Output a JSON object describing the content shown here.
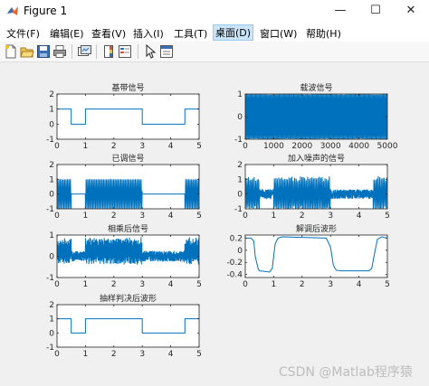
{
  "window": {
    "title": "Figure 1",
    "minimize": "—",
    "maximize": "☐",
    "close": "✕"
  },
  "menu": [
    "文件(F)",
    "编辑(E)",
    "查看(V)",
    "插入(I)",
    "工具(T)",
    "桌面(D)",
    "窗口(W)",
    "帮助(H)"
  ],
  "menu_active_index": 5,
  "toolbar_icons": [
    "new-figure-icon",
    "open-file-icon",
    "save-icon",
    "print-icon",
    "link-plot-icon",
    "insert-colorbar-icon",
    "insert-legend-icon",
    "edit-plot-icon",
    "property-inspector-icon"
  ],
  "colors": {
    "line": "#0072BD",
    "axes_bg": "#ffffff",
    "figure_bg": "#f0f0f0"
  },
  "chart_data": [
    {
      "type": "line",
      "title": "基带信号",
      "xlim": [
        0,
        5
      ],
      "ylim": [
        -1,
        2
      ],
      "xticks": [
        "0",
        "1",
        "2",
        "3",
        "4",
        "5"
      ],
      "yticks": [
        "2",
        "1",
        "0",
        "-1"
      ],
      "x": [
        0,
        0.5,
        0.5,
        1,
        1,
        3,
        3,
        4.5,
        4.5,
        5
      ],
      "y": [
        1,
        1,
        0,
        0,
        1,
        1,
        0,
        0,
        1,
        1
      ]
    },
    {
      "type": "line",
      "title": "载波信号",
      "xlim": [
        0,
        5000
      ],
      "ylim": [
        -1,
        1
      ],
      "xticks": [
        "0",
        "1000",
        "2000",
        "3000",
        "4000",
        "5000"
      ],
      "yticks": [
        "1",
        "0",
        "-1"
      ],
      "signal": "carrier",
      "amplitude": 1
    },
    {
      "type": "line",
      "title": "已调信号",
      "xlim": [
        0,
        5
      ],
      "ylim": [
        -1,
        2
      ],
      "xticks": [
        "0",
        "1",
        "2",
        "3",
        "4",
        "5"
      ],
      "yticks": [
        "2",
        "1",
        "0",
        "-1"
      ],
      "signal": "ook",
      "amplitude": 1
    },
    {
      "type": "line",
      "title": "加入噪声的信号",
      "xlim": [
        0,
        5
      ],
      "ylim": [
        -1,
        2
      ],
      "xticks": [
        "0",
        "1",
        "2",
        "3",
        "4",
        "5"
      ],
      "yticks": [
        "2",
        "1",
        "0",
        "-1"
      ],
      "signal": "ook+noise",
      "amplitude": 1
    },
    {
      "type": "line",
      "title": "相乘后信号",
      "xlim": [
        0,
        5
      ],
      "ylim": [
        -1,
        1
      ],
      "xticks": [
        "0",
        "1",
        "2",
        "3",
        "4",
        "5"
      ],
      "yticks": [
        "1",
        "0",
        "-1"
      ],
      "signal": "product"
    },
    {
      "type": "line",
      "title": "解调后波形",
      "xlim": [
        0,
        5
      ],
      "ylim": [
        -0.45,
        0.25
      ],
      "xticks": [
        "0",
        "1",
        "2",
        "3",
        "4",
        "5"
      ],
      "yticks": [
        "0.2",
        "0",
        "-0.2",
        "-0.4"
      ],
      "x": [
        0,
        0.2,
        0.3,
        0.35,
        0.45,
        0.5,
        0.7,
        0.85,
        0.95,
        1.05,
        1.15,
        1.3,
        2.85,
        3.0,
        3.1,
        3.2,
        3.4,
        4.35,
        4.45,
        4.55,
        4.65,
        4.8,
        5
      ],
      "y": [
        0.2,
        0.2,
        0.15,
        -0.1,
        -0.3,
        -0.34,
        -0.35,
        -0.36,
        -0.3,
        0.1,
        0.2,
        0.22,
        0.2,
        0.05,
        -0.25,
        -0.33,
        -0.34,
        -0.34,
        -0.3,
        -0.05,
        0.18,
        0.22,
        0.2
      ]
    },
    {
      "type": "line",
      "title": "抽样判决后波形",
      "xlim": [
        0,
        5
      ],
      "ylim": [
        -1,
        2
      ],
      "xticks": [
        "0",
        "1",
        "2",
        "3",
        "4",
        "5"
      ],
      "yticks": [
        "2",
        "1",
        "0",
        "-1"
      ],
      "x": [
        0,
        0.5,
        0.5,
        1,
        1,
        3,
        3,
        4.5,
        4.5,
        5
      ],
      "y": [
        1,
        1,
        0,
        0,
        1,
        1,
        0,
        0,
        1,
        1
      ]
    }
  ],
  "watermark": "CSDN @Matlab程序猿"
}
